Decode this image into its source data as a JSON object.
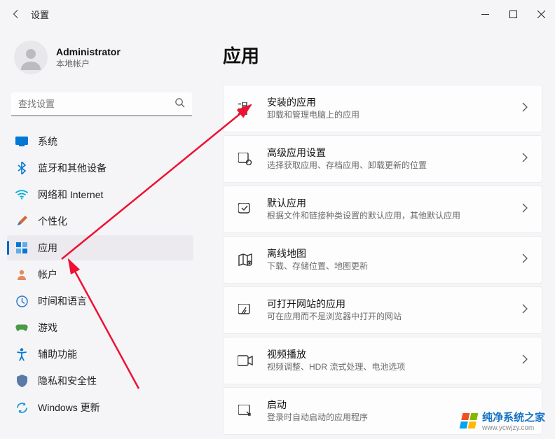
{
  "window": {
    "title": "设置"
  },
  "user": {
    "name": "Administrator",
    "subtitle": "本地帐户"
  },
  "search": {
    "placeholder": "查找设置"
  },
  "nav": {
    "items": [
      {
        "label": "系统"
      },
      {
        "label": "蓝牙和其他设备"
      },
      {
        "label": "网络和 Internet"
      },
      {
        "label": "个性化"
      },
      {
        "label": "应用"
      },
      {
        "label": "帐户"
      },
      {
        "label": "时间和语言"
      },
      {
        "label": "游戏"
      },
      {
        "label": "辅助功能"
      },
      {
        "label": "隐私和安全性"
      },
      {
        "label": "Windows 更新"
      }
    ]
  },
  "main": {
    "heading": "应用",
    "cards": [
      {
        "title": "安装的应用",
        "sub": "卸载和管理电脑上的应用"
      },
      {
        "title": "高级应用设置",
        "sub": "选择获取应用、存档应用、卸载更新的位置"
      },
      {
        "title": "默认应用",
        "sub": "根据文件和链接种类设置的默认应用，其他默认应用"
      },
      {
        "title": "离线地图",
        "sub": "下载、存储位置、地图更新"
      },
      {
        "title": "可打开网站的应用",
        "sub": "可在应用而不是浏览器中打开的网站"
      },
      {
        "title": "视频播放",
        "sub": "视频调整、HDR 流式处理、电池选项"
      },
      {
        "title": "启动",
        "sub": "登录时自动启动的应用程序"
      }
    ]
  },
  "watermark": {
    "name": "纯净系统之家",
    "url": "www.ycwjzy.com"
  }
}
